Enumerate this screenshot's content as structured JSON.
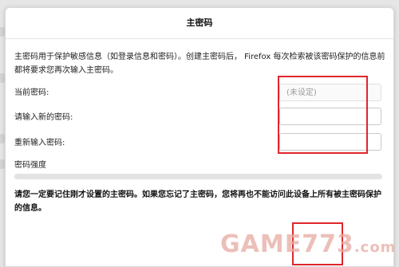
{
  "dialog": {
    "title": "主密码",
    "description": "主密码用于保护敏感信息（如登录信息和密码）。创建主密码后， Firefox 每次检索被该密码保护的信息前都将要求您再次输入主密码。",
    "fields": [
      {
        "label": "当前密码:",
        "value": "",
        "placeholder": "(未设定)",
        "disabled": true
      },
      {
        "label": "请输入新的密码:",
        "value": "",
        "placeholder": ""
      },
      {
        "label": "重新输入密码:",
        "value": "",
        "placeholder": ""
      }
    ],
    "strength_label": "密码强度",
    "strength_level": 0,
    "warning": "请您一定要记住刚才设置的主密码。如果您忘记了主密码，您将再也不能访问此设备上所有被主密码保护的信息。"
  },
  "watermark": {
    "text": "GAME773",
    "suffix": ".com"
  },
  "colors": {
    "annotation": "#e0262b",
    "watermark": "#e6aaa0"
  }
}
